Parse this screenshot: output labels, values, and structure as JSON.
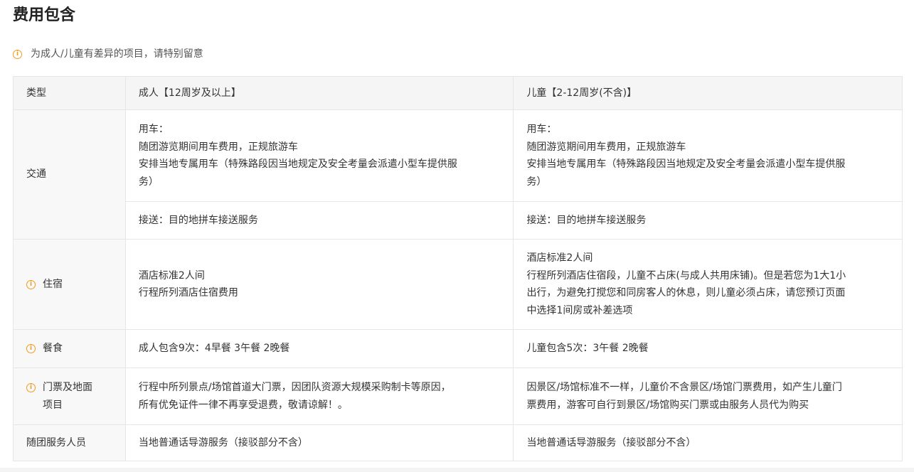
{
  "section": {
    "title": "费用包含",
    "note": "为成人/儿童有差异的项目，请特别留意"
  },
  "table": {
    "headers": {
      "type": "类型",
      "adult": "成人【12周岁及以上】",
      "child": "儿童【2-12周岁(不含)】"
    },
    "rows": {
      "transport": {
        "type": "交通",
        "car": {
          "adult": [
            "用车：",
            "随团游览期间用车费用，正规旅游车",
            "安排当地专属用车（特殊路段因当地规定及安全考量会派遣小型车提供服",
            "务）"
          ],
          "child": [
            "用车：",
            "随团游览期间用车费用，正规旅游车",
            "安排当地专属用车（特殊路段因当地规定及安全考量会派遣小型车提供服",
            "务）"
          ]
        },
        "pickup": {
          "adult": "接送：目的地拼车接送服务",
          "child": "接送：目的地拼车接送服务"
        }
      },
      "hotel": {
        "type": "住宿",
        "adult": [
          "酒店标准2人间",
          "行程所列酒店住宿费用"
        ],
        "child": [
          "酒店标准2人间",
          "行程所列酒店住宿段，儿童不占床(与成人共用床铺)。但是若您为1大1小",
          "出行，为避免打搅您和同房客人的休息，则儿童必须占床，请您预订页面",
          "中选择1间房或补差选项"
        ]
      },
      "meals": {
        "type": "餐食",
        "adult": "成人包含9次：4早餐 3午餐 2晚餐",
        "child": "儿童包含5次：3午餐 2晚餐"
      },
      "tickets": {
        "type": [
          "门票及地面",
          "项目"
        ],
        "adult": [
          "行程中所列景点/场馆首道大门票，因团队资源大规模采购制卡等原因，",
          "所有优免证件一律不再享受退费，敬请谅解！。"
        ],
        "child": [
          "因景区/场馆标准不一样，儿童价不含景区/场馆门票费用，如产生儿童门",
          "票费用，游客可自行到景区/场馆购买门票或由服务人员代为购买"
        ]
      },
      "guide": {
        "type": "随团服务人员",
        "adult": "当地普通话导游服务（接驳部分不含）",
        "child": "当地普通话导游服务（接驳部分不含）"
      }
    }
  },
  "colors": {
    "accent": "#f29b1e",
    "border": "#e6e6e6",
    "header_bg": "#f5f5f5"
  },
  "icons": {
    "info": "info-circle-icon"
  }
}
